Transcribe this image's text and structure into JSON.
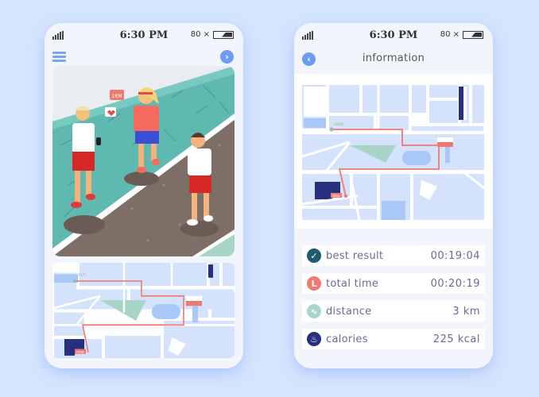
{
  "colors": {
    "background": "#d6e5fe",
    "phone": "#f2f6fc",
    "accent_blue": "#6e9cf2",
    "route_red": "#f07a72",
    "map_block": "#d4e3fb",
    "map_pond": "#a9c8f7",
    "map_park": "#a8d4c8",
    "map_building_dark": "#26307f",
    "stat_text": "#6a6a9a"
  },
  "left_screen": {
    "status": {
      "time": "6:30 PM",
      "battery": "80 ×"
    },
    "nav": {
      "menu_icon": "hamburger-menu-icon",
      "next_icon": "chevron-right-icon",
      "next_glyph": "›"
    },
    "photo": {
      "sign_text": "1KM",
      "description": "three people jogging on a park path"
    },
    "map": {
      "start_label": "start",
      "stop_label": "stop"
    }
  },
  "right_screen": {
    "status": {
      "time": "6:30 PM",
      "battery": "80 ×"
    },
    "nav": {
      "back_icon": "chevron-left-icon",
      "back_glyph": "‹",
      "title": "information"
    },
    "map": {
      "start_label": "start",
      "stop_label": "stop"
    },
    "stats": [
      {
        "icon": "checkmark-icon",
        "glyph": "✓",
        "color": "#1f5a6e",
        "label": "best result",
        "value": "00:19:04"
      },
      {
        "icon": "clock-icon",
        "glyph": "L",
        "color": "#f07a72",
        "label": "total time",
        "value": "00:20:19"
      },
      {
        "icon": "distance-wave-icon",
        "glyph": "∿",
        "color": "#a8d4d0",
        "label": "distance",
        "value": "3 km"
      },
      {
        "icon": "flame-icon",
        "glyph": "♨",
        "color": "#27307f",
        "label": "calories",
        "value": "225 kcal"
      }
    ]
  }
}
